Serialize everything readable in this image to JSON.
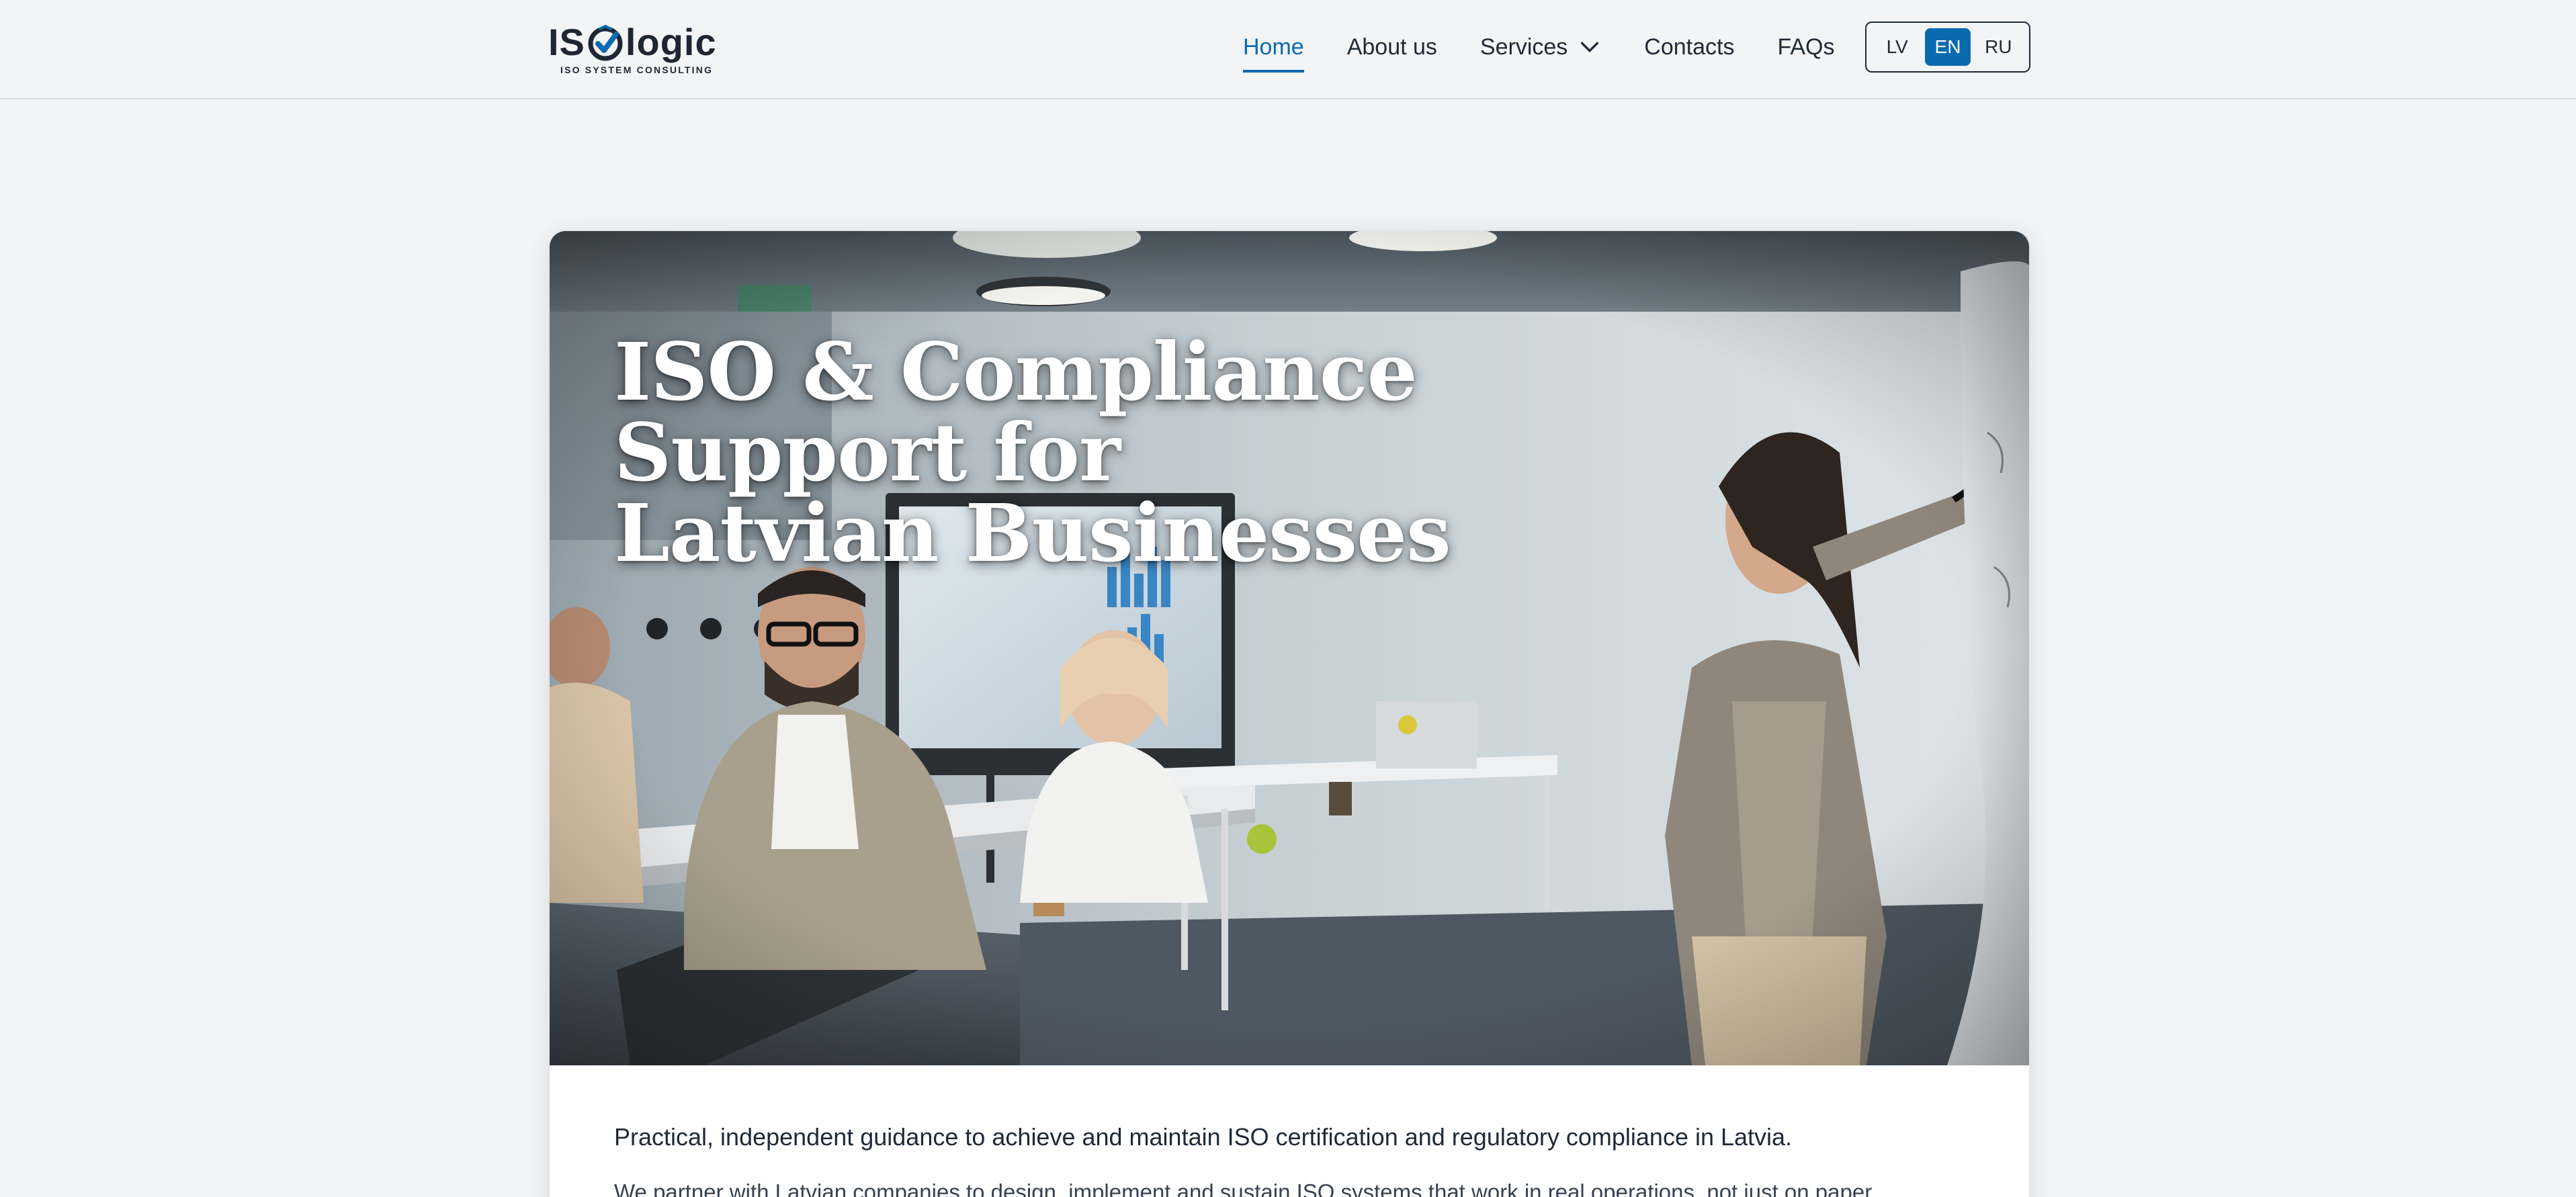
{
  "header": {
    "logo": {
      "text_left": "IS",
      "text_right": "logic",
      "tagline": "ISO SYSTEM CONSULTING",
      "icon": "check-shield-icon"
    },
    "nav": [
      {
        "label": "Home",
        "active": true
      },
      {
        "label": "About us",
        "active": false
      },
      {
        "label": "Services",
        "active": false,
        "icon": "chevron-down-icon"
      },
      {
        "label": "Contacts",
        "active": false
      },
      {
        "label": "FAQs",
        "active": false
      }
    ],
    "languages": [
      {
        "label": "LV",
        "active": false
      },
      {
        "label": "EN",
        "active": true
      },
      {
        "label": "RU",
        "active": false
      }
    ]
  },
  "hero": {
    "title_lines": [
      "ISO & Compliance",
      "Support for",
      "Latvian Businesses"
    ],
    "image_alt": "Presenter at a whiteboard in a meeting room"
  },
  "content": {
    "lead": "Practical, independent guidance to achieve and maintain ISO certification and regulatory compliance in Latvia.",
    "paragraph": "We partner with Latvian companies to design, implement and sustain ISO systems that work in real operations, not just on paper."
  },
  "colors": {
    "accent": "#0a6ab0",
    "background": "#f3f4f6",
    "text": "#1f2937"
  }
}
